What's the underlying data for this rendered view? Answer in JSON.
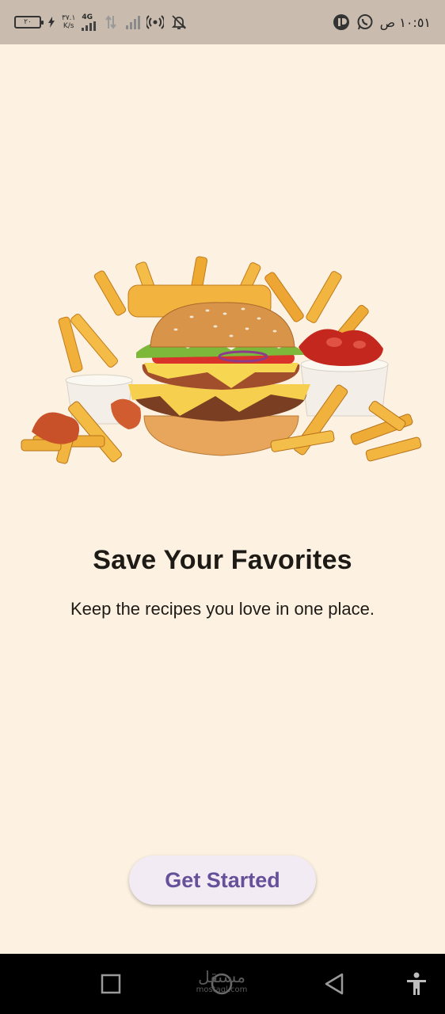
{
  "status_bar": {
    "battery_level": "٢٠",
    "network_speed_value": "٣٧.١",
    "network_speed_unit": "K/s",
    "network_type": "4G",
    "time": "١٠:٥١ ص",
    "icons": [
      "battery-icon",
      "charging-icon",
      "signal-icon",
      "data-arrows-icon",
      "signal-weak-icon",
      "hotspot-icon",
      "bell-off-icon",
      "app-notification-icon",
      "whatsapp-icon"
    ]
  },
  "onboarding": {
    "image_icon": "burger-fries-illustration",
    "title": "Save Your Favorites",
    "subtitle": "Keep the recipes you love in one place.",
    "cta_label": "Get Started"
  },
  "nav_bar": {
    "watermark_ar": "مستقل",
    "watermark_en": "mostaql.com",
    "icons": [
      "recents-square-icon",
      "home-circle-icon",
      "back-triangle-icon",
      "accessibility-icon"
    ]
  },
  "colors": {
    "background": "#fdf2e1",
    "status_bar": "#c9bcae",
    "button_bg": "#f3ebf4",
    "button_text": "#65509a",
    "text": "#1e1b16"
  }
}
